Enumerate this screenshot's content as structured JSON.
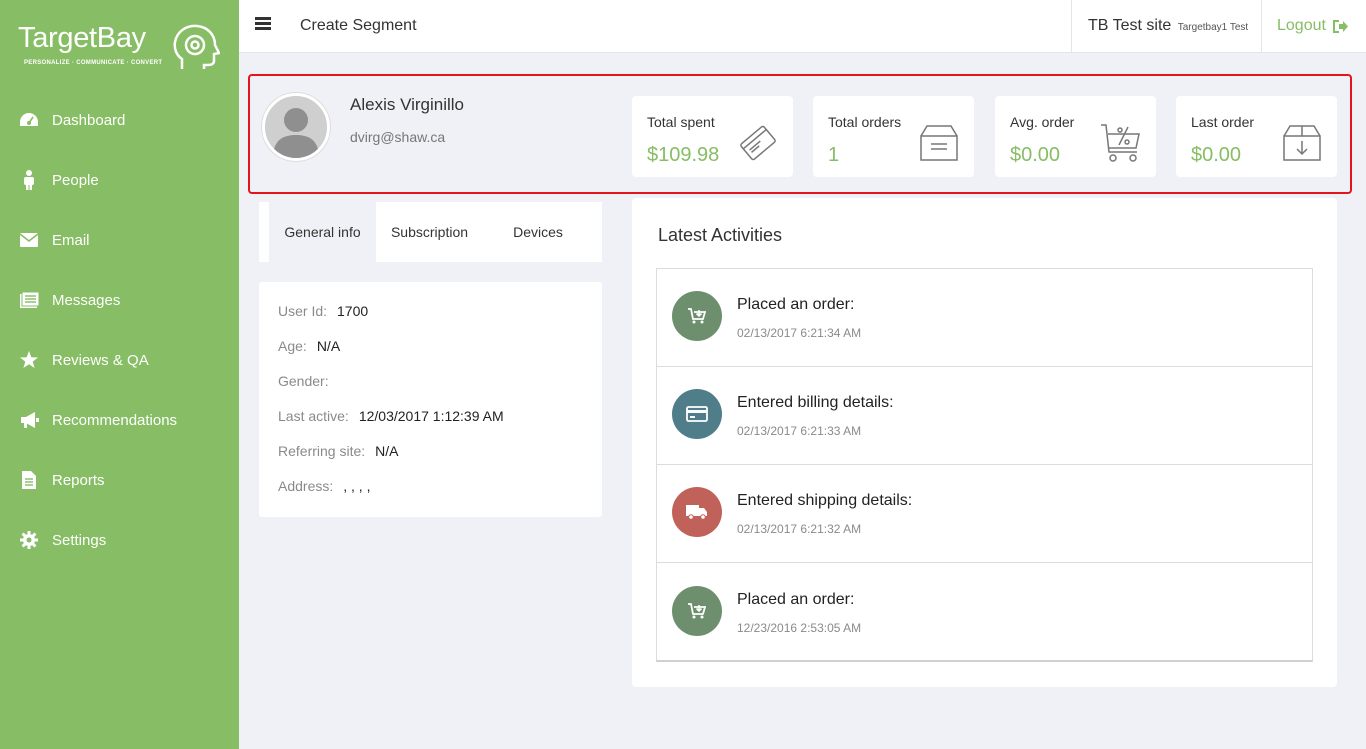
{
  "brand": {
    "name": "TargetBay",
    "tagline": "PERSONALIZE · COMMUNICATE · CONVERT",
    "accent_color": "#87bd64"
  },
  "sidebar": {
    "items": [
      {
        "label": "Dashboard",
        "icon": "dashboard-icon"
      },
      {
        "label": "People",
        "icon": "person-icon"
      },
      {
        "label": "Email",
        "icon": "envelope-icon"
      },
      {
        "label": "Messages",
        "icon": "messages-icon"
      },
      {
        "label": "Reviews & QA",
        "icon": "star-icon"
      },
      {
        "label": "Recommendations",
        "icon": "megaphone-icon"
      },
      {
        "label": "Reports",
        "icon": "document-icon"
      },
      {
        "label": "Settings",
        "icon": "gear-icon"
      }
    ]
  },
  "header": {
    "title": "Create Segment",
    "site_name": "TB Test site",
    "site_sub": "Targetbay1 Test",
    "logout_label": "Logout"
  },
  "profile": {
    "name": "Alexis Virginillo",
    "email": "dvirg@shaw.ca"
  },
  "stats": [
    {
      "label": "Total spent",
      "value": "$109.98",
      "icon": "credit-card-icon"
    },
    {
      "label": "Total orders",
      "value": "1",
      "icon": "box-icon"
    },
    {
      "label": "Avg. order",
      "value": "$0.00",
      "icon": "cart-percent-icon"
    },
    {
      "label": "Last order",
      "value": "$0.00",
      "icon": "box-download-icon"
    }
  ],
  "tabs": [
    {
      "label": "General info",
      "active": true
    },
    {
      "label": "Subscription",
      "active": false
    },
    {
      "label": "Devices",
      "active": false
    }
  ],
  "general_info": [
    {
      "key": "User Id:",
      "value": "1700"
    },
    {
      "key": "Age:",
      "value": "N/A"
    },
    {
      "key": "Gender:",
      "value": ""
    },
    {
      "key": "Last active:",
      "value": "12/03/2017 1:12:39 AM"
    },
    {
      "key": "Referring site:",
      "value": "N/A"
    },
    {
      "key": "Address:",
      "value": ", , , ,"
    }
  ],
  "activities": {
    "title": "Latest Activities",
    "items": [
      {
        "text": "Placed an order:",
        "time": "02/13/2017 6:21:34 AM",
        "icon": "cart-icon",
        "color": "#6e8f6e"
      },
      {
        "text": "Entered billing details:",
        "time": "02/13/2017 6:21:33 AM",
        "icon": "card-icon",
        "color": "#4f7d8a"
      },
      {
        "text": "Entered shipping details:",
        "time": "02/13/2017 6:21:32 AM",
        "icon": "truck-icon",
        "color": "#c0625a"
      },
      {
        "text": "Placed an order:",
        "time": "12/23/2016 2:53:05 AM",
        "icon": "cart-icon",
        "color": "#6e8f6e"
      }
    ]
  }
}
